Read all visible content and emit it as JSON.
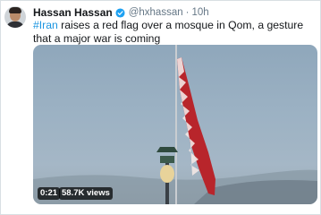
{
  "tweet": {
    "author": {
      "display_name": "Hassan Hassan",
      "handle": "@hxhassan",
      "verified_icon": "verified-badge-icon"
    },
    "separator": "·",
    "time": "10h",
    "hashtag": "#Iran",
    "body": " raises a red flag over a mosque in Qom, a gesture that a major war is coming",
    "media": {
      "duration": "0:21",
      "views": "58.7K views"
    }
  },
  "colors": {
    "link": "#1b95e0",
    "verified": "#1da1f2",
    "flag": "#b8252b",
    "secondary_text": "#657786"
  }
}
